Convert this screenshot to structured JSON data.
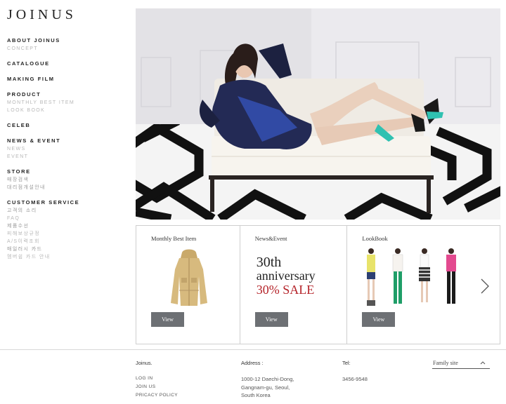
{
  "brand": {
    "logo": "JOINUS"
  },
  "nav": {
    "about": {
      "label": "ABOUT JOINUS",
      "items": [
        "CONCEPT"
      ]
    },
    "catalogue": {
      "label": "CATALOGUE"
    },
    "making_film": {
      "label": "MAKING FILM"
    },
    "product": {
      "label": "PRODUCT",
      "items": [
        "MONTHLY BEST ITEM",
        "LOOK BOOK"
      ]
    },
    "celeb": {
      "label": "CELEB"
    },
    "news_event": {
      "label": "NEWS & EVENT",
      "items": [
        "NEWS",
        "EVENT"
      ]
    },
    "store": {
      "label": "STORE",
      "items": [
        "매장검색",
        "대리점개설안내"
      ]
    },
    "customer_service": {
      "label": "CUSTOMER SERVICE",
      "items": [
        "고객의 소리",
        "FAQ",
        "제품수선",
        "피해보상규정",
        "A/S이력조회",
        "매일러시 카드",
        "멤버쉽 카드 안내"
      ]
    }
  },
  "features": {
    "monthly": {
      "title": "Monthly Best Item",
      "button": "View"
    },
    "news": {
      "title": "News&Event",
      "line1": "30th",
      "line2": "anniversary",
      "line3": "30% SALE",
      "button": "View"
    },
    "lookbook": {
      "title": "LookBook",
      "button": "View"
    }
  },
  "footer": {
    "company": "Joinus.",
    "links": [
      "LOG IN",
      "JOIN US",
      "PRICACY POLICY"
    ],
    "address_label": "Address :",
    "address_lines": [
      "1000-12 Daechi-Dong,",
      "Gangnam-gu, Seoul,",
      "South Korea"
    ],
    "tel_label": "Tel:",
    "tel": "3456-9548",
    "family_site": "Family site"
  },
  "colors": {
    "sale_red": "#b5242a",
    "button_gray": "#6d7074"
  }
}
